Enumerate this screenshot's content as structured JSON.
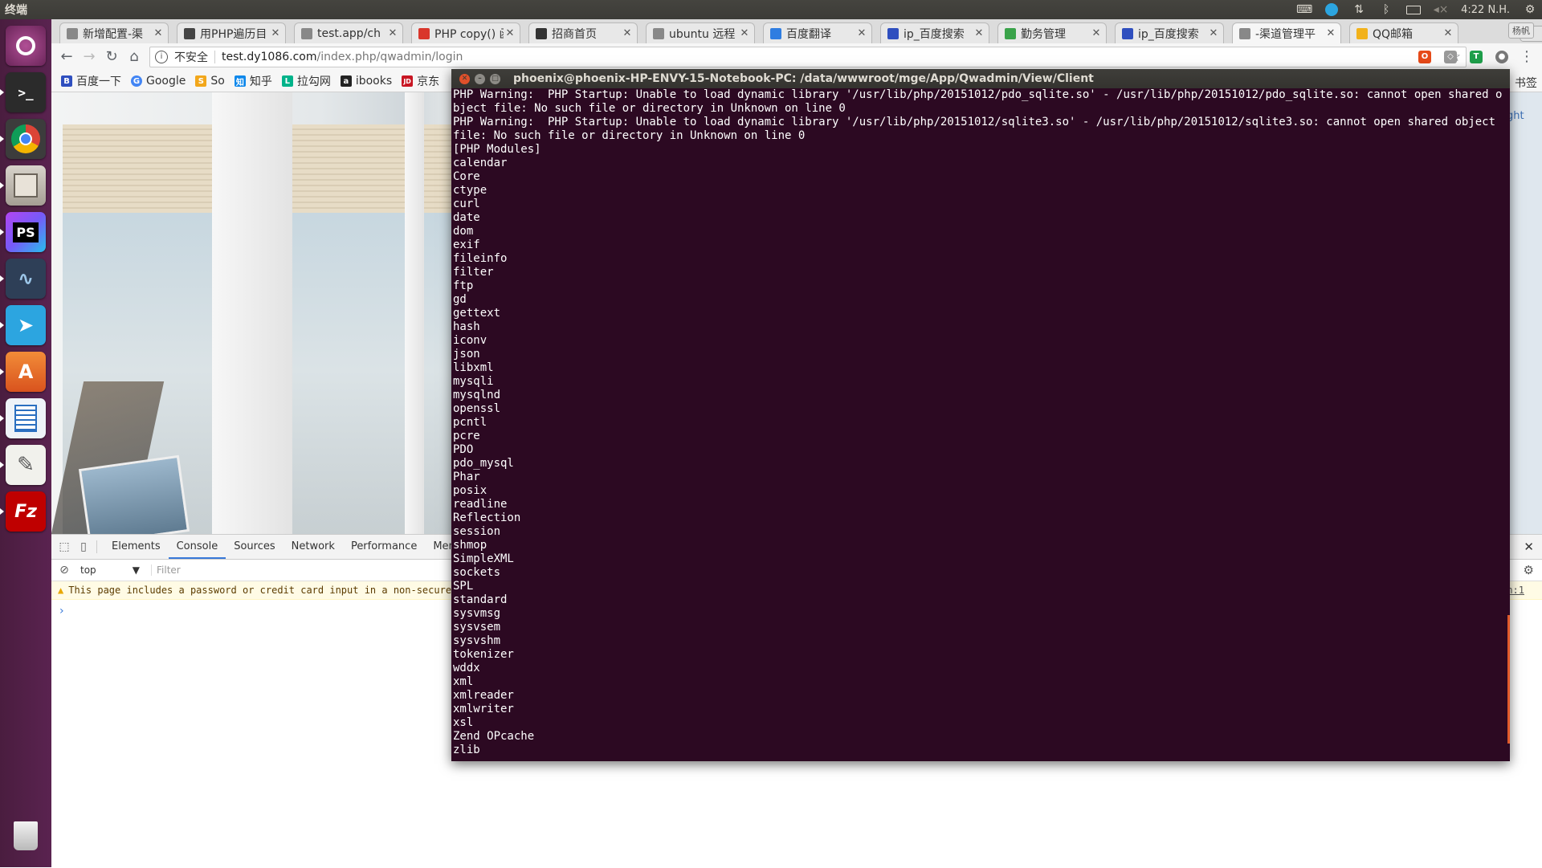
{
  "top_panel": {
    "title": "终端",
    "clock": "4:22 N.H."
  },
  "launcher": {
    "items": [
      {
        "name": "ubuntu-dash",
        "label": ""
      },
      {
        "name": "terminal",
        "label": ""
      },
      {
        "name": "chrome",
        "label": ""
      },
      {
        "name": "files",
        "label": ""
      },
      {
        "name": "phpstorm",
        "label": "PS"
      },
      {
        "name": "mysql-workbench",
        "label": ""
      },
      {
        "name": "telegram",
        "label": ""
      },
      {
        "name": "software-center",
        "label": "A"
      },
      {
        "name": "libreoffice-writer",
        "label": ""
      },
      {
        "name": "text-editor",
        "label": ""
      },
      {
        "name": "filezilla",
        "label": "Fz"
      },
      {
        "name": "trash",
        "label": ""
      }
    ]
  },
  "browser": {
    "tabs": [
      {
        "label": "新增配置-渠",
        "color": "#888888"
      },
      {
        "label": "用PHP遍历目",
        "color": "#444444"
      },
      {
        "label": "test.app/ch",
        "color": "#888888"
      },
      {
        "label": "PHP copy() 函",
        "color": "#d9362b"
      },
      {
        "label": "招商首页",
        "color": "#333333"
      },
      {
        "label": "ubuntu 远程",
        "color": "#888888"
      },
      {
        "label": "百度翻译",
        "color": "#2f7de1"
      },
      {
        "label": "ip_百度搜索",
        "color": "#2f4fbf"
      },
      {
        "label": "勤务管理",
        "color": "#3aa34a"
      },
      {
        "label": "ip_百度搜索",
        "color": "#2f4fbf"
      },
      {
        "label": "-渠道管理平",
        "color": "#888888"
      },
      {
        "label": "QQ邮箱",
        "color": "#f2b21b"
      }
    ],
    "profile": "杨帆",
    "security_label": "不安全",
    "url_host": "test.dy1086.com",
    "url_path": "/index.php/qwadmin/login",
    "bookmarks": [
      {
        "label": "百度一下",
        "icon": "B",
        "color": "#2f4fbf"
      },
      {
        "label": "Google",
        "icon": "G",
        "color": "#4285f4"
      },
      {
        "label": "So",
        "icon": "S",
        "color": "#f2a71b"
      },
      {
        "label": "知乎",
        "icon": "知",
        "color": "#0f88eb"
      },
      {
        "label": "拉勾网",
        "icon": "L",
        "color": "#00b38a"
      },
      {
        "label": "ibooks",
        "icon": "a",
        "color": "#222222"
      },
      {
        "label": "京东",
        "icon": "JD",
        "color": "#c81623"
      }
    ],
    "bookmarks_other": "书签",
    "page_right_text": "ght"
  },
  "devtools": {
    "tabs": [
      "Elements",
      "Console",
      "Sources",
      "Network",
      "Performance",
      "Memory"
    ],
    "active_tab": "Console",
    "context": "top",
    "filter_placeholder": "Filter",
    "warning": "This page includes a password or credit card input in a non-secure context.",
    "warning_source": "n:1",
    "prompt": "›"
  },
  "terminal": {
    "title": "phoenix@phoenix-HP-ENVY-15-Notebook-PC: /data/wwwroot/mge/App/Qwadmin/View/Client",
    "lines": [
      "PHP Warning:  PHP Startup: Unable to load dynamic library '/usr/lib/php/20151012/pdo_sqlite.so' - /usr/lib/php/20151012/pdo_sqlite.so: cannot open shared object file: No such file or directory in Unknown on line 0",
      "PHP Warning:  PHP Startup: Unable to load dynamic library '/usr/lib/php/20151012/sqlite3.so' - /usr/lib/php/20151012/sqlite3.so: cannot open shared object file: No such file or directory in Unknown on line 0",
      "[PHP Modules]",
      "calendar",
      "Core",
      "ctype",
      "curl",
      "date",
      "dom",
      "exif",
      "fileinfo",
      "filter",
      "ftp",
      "gd",
      "gettext",
      "hash",
      "iconv",
      "json",
      "libxml",
      "mysqli",
      "mysqlnd",
      "openssl",
      "pcntl",
      "pcre",
      "PDO",
      "pdo_mysql",
      "Phar",
      "posix",
      "readline",
      "Reflection",
      "session",
      "shmop",
      "SimpleXML",
      "sockets",
      "SPL",
      "standard",
      "sysvmsg",
      "sysvsem",
      "sysvshm",
      "tokenizer",
      "wddx",
      "xml",
      "xmlreader",
      "xmlwriter",
      "xsl",
      "Zend OPcache",
      "zlib"
    ]
  }
}
